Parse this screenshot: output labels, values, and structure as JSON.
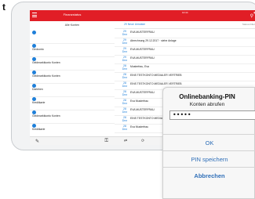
{
  "page_letter": "t",
  "left_panel": {
    "title": "Finanzstatus",
    "subtitle": "Alle Konten",
    "accounts": [
      {
        "name": "",
        "sub": "",
        "amount": "",
        "date": ""
      },
      {
        "name": "Girokonto",
        "sub": "",
        "amount": "",
        "date": ""
      },
      {
        "name": "Geldmarktkonto Konten",
        "sub": "",
        "amount": "",
        "date": ""
      },
      {
        "name": "Geldmarktkonto Konten",
        "sub": "",
        "amount": "",
        "date": ""
      },
      {
        "name": "Darlehen",
        "sub": "",
        "amount": "",
        "date": ""
      },
      {
        "name": "Kreditkarte",
        "sub": "",
        "amount": "",
        "date": ""
      },
      {
        "name": "Geldmarktkonto Konten",
        "sub": "",
        "amount": "",
        "date": ""
      },
      {
        "name": "Kreditkarte",
        "sub": "",
        "amount": "",
        "date": ""
      }
    ]
  },
  "right_panel": {
    "status_time": "10:44",
    "subheader_left": "29 Neue Umsätze",
    "subheader_right": "Status-Filter",
    "transactions": [
      {
        "day": "29",
        "month": "Dez",
        "title": "EVA MUSTERFRAU",
        "sub": "",
        "amount": "",
        "negative": false
      },
      {
        "day": "29",
        "month": "Dez",
        "title": "Abrechnung 29.12.2017 · siehe Anlage",
        "sub": "",
        "amount": "",
        "negative": false
      },
      {
        "day": "29",
        "month": "Dez",
        "title": "EVA MUSTERFRAU",
        "sub": "",
        "amount": "",
        "negative": false
      },
      {
        "day": "29",
        "month": "Dez",
        "title": "EVA MUSTERFRAU",
        "sub": "",
        "amount": "",
        "negative": false
      },
      {
        "day": "28",
        "month": "Dez",
        "title": "Musterfrau, Eva",
        "sub": "",
        "amount": "",
        "negative": true
      },
      {
        "day": "28",
        "month": "Dez",
        "title": "EINS TESTKONTO MEDIALER VERTRIEB",
        "sub": "",
        "amount": "",
        "negative": false
      },
      {
        "day": "28",
        "month": "Dez",
        "title": "EINS TESTKONTO MEDIALER VERTRIEB",
        "sub": "",
        "amount": "",
        "negative": false
      },
      {
        "day": "28",
        "month": "Dez",
        "title": "EVA MUSTERFRAU",
        "sub": "",
        "amount": "",
        "negative": false
      },
      {
        "day": "28",
        "month": "Dez",
        "title": "Eva Musterfrau",
        "sub": "",
        "amount": "",
        "negative": false
      },
      {
        "day": "28",
        "month": "Dez",
        "title": "EVA MUSTERFRAU",
        "sub": "",
        "amount": "",
        "negative": false
      },
      {
        "day": "28",
        "month": "Dez",
        "title": "EINS TESTKONTO MEDIALER VERTRIEB",
        "sub": "",
        "amount": "",
        "negative": false
      },
      {
        "day": "28",
        "month": "Dez",
        "title": "Eva Musterfrau",
        "sub": "",
        "amount": "",
        "negative": false
      }
    ]
  },
  "dialog": {
    "title": "Onlinebanking-PIN",
    "subtitle": "Konten abrufen",
    "pin_value": "•••••",
    "ok_label": "OK",
    "save_label": "PIN speichern",
    "cancel_label": "Abbrechen"
  },
  "colors": {
    "accent": "#e11e26",
    "link": "#1e7fd9",
    "button_text": "#2f6fb8",
    "positive": "#2fb24a"
  },
  "icons": [
    "menu-icon",
    "search-icon",
    "pencil-icon",
    "key-icon"
  ]
}
